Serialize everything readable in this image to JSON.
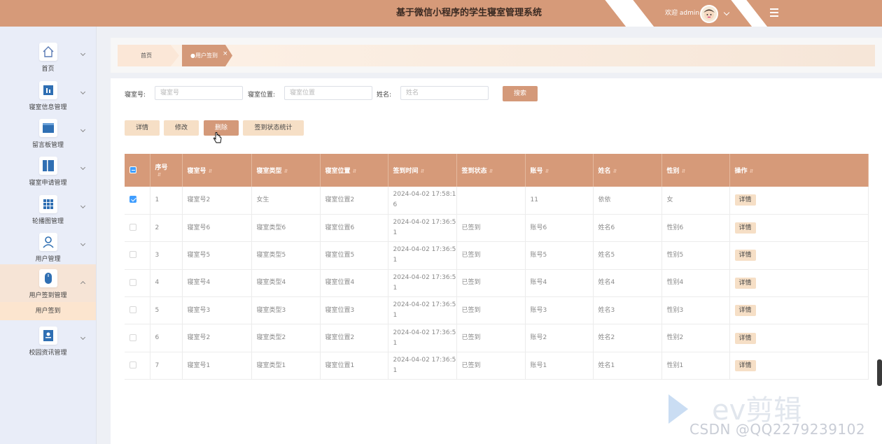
{
  "header": {
    "title": "基于微信小程序的学生寝室管理系统",
    "welcome": "欢迎 admin"
  },
  "sidebar": {
    "items": [
      {
        "label": "首页",
        "icon": "home-icon"
      },
      {
        "label": "寝室信息管理",
        "icon": "chart-icon"
      },
      {
        "label": "留言板管理",
        "icon": "board-icon"
      },
      {
        "label": "寝室申请管理",
        "icon": "book-icon"
      },
      {
        "label": "轮播图管理",
        "icon": "grid-icon"
      },
      {
        "label": "用户管理",
        "icon": "user-icon"
      },
      {
        "label": "用户签到管理",
        "icon": "mouse-icon"
      },
      {
        "label": "校园资讯管理",
        "icon": "news-icon"
      }
    ],
    "sub_item": "用户签到"
  },
  "breadcrumb": {
    "home": "首页",
    "current": "●用户签到",
    "close": "×"
  },
  "search": {
    "room_label": "寝室号:",
    "room_placeholder": "寝室号",
    "location_label": "寝室位置:",
    "location_placeholder": "寝室位置",
    "name_label": "姓名:",
    "name_placeholder": "姓名",
    "button": "搜索"
  },
  "actions": {
    "detail": "详情",
    "edit": "修改",
    "delete": "删除",
    "stats": "签到状态统计"
  },
  "table": {
    "headers": [
      "序号",
      "寝室号",
      "寝室类型",
      "寝室位置",
      "签到时间",
      "签到状态",
      "账号",
      "姓名",
      "性别",
      "操作"
    ],
    "row_button": "详情",
    "rows": [
      {
        "checked": true,
        "idx": "1",
        "room": "寝室号2",
        "type": "女生",
        "location": "寝室位置2",
        "time1": "2024-04-02 17:58:1",
        "time2": "6",
        "status": "",
        "account": "11",
        "name": "依依",
        "gender": "女"
      },
      {
        "checked": false,
        "idx": "2",
        "room": "寝室号6",
        "type": "寝室类型6",
        "location": "寝室位置6",
        "time1": "2024-04-02 17:36:5",
        "time2": "1",
        "status": "已签到",
        "account": "账号6",
        "name": "姓名6",
        "gender": "性别6"
      },
      {
        "checked": false,
        "idx": "3",
        "room": "寝室号5",
        "type": "寝室类型5",
        "location": "寝室位置5",
        "time1": "2024-04-02 17:36:5",
        "time2": "1",
        "status": "已签到",
        "account": "账号5",
        "name": "姓名5",
        "gender": "性别5"
      },
      {
        "checked": false,
        "idx": "4",
        "room": "寝室号4",
        "type": "寝室类型4",
        "location": "寝室位置4",
        "time1": "2024-04-02 17:36:5",
        "time2": "1",
        "status": "已签到",
        "account": "账号4",
        "name": "姓名4",
        "gender": "性别4"
      },
      {
        "checked": false,
        "idx": "5",
        "room": "寝室号3",
        "type": "寝室类型3",
        "location": "寝室位置3",
        "time1": "2024-04-02 17:36:5",
        "time2": "1",
        "status": "已签到",
        "account": "账号3",
        "name": "姓名3",
        "gender": "性别3"
      },
      {
        "checked": false,
        "idx": "6",
        "room": "寝室号2",
        "type": "寝室类型2",
        "location": "寝室位置2",
        "time1": "2024-04-02 17:36:5",
        "time2": "1",
        "status": "已签到",
        "account": "账号2",
        "name": "姓名2",
        "gender": "性别2"
      },
      {
        "checked": false,
        "idx": "7",
        "room": "寝室号1",
        "type": "寝室类型1",
        "location": "寝室位置1",
        "time1": "2024-04-02 17:36:5",
        "time2": "1",
        "status": "已签到",
        "account": "账号1",
        "name": "姓名1",
        "gender": "性别1"
      }
    ]
  },
  "watermark": {
    "ev": "ev剪辑",
    "csdn": "CSDN @QQ2279239102"
  },
  "colors": {
    "accent": "#d69a79",
    "button_light": "#f6dfc6",
    "sidebar_bg": "#e9edf8",
    "checkbox": "#409eff"
  }
}
